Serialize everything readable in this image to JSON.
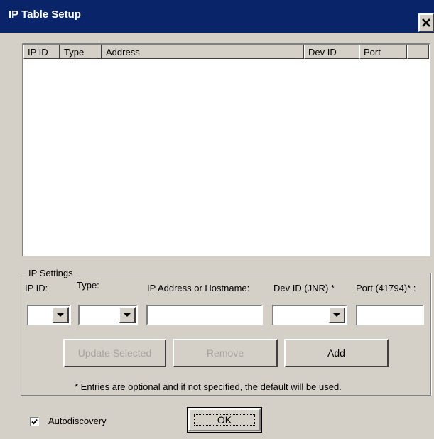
{
  "window": {
    "title": "IP Table Setup",
    "close_icon": "close-icon"
  },
  "table": {
    "columns": [
      "IP ID",
      "Type",
      "Address",
      "Dev ID",
      "Port"
    ],
    "rows": []
  },
  "ip_settings": {
    "group_label": "IP Settings",
    "ip_id": {
      "label": "IP ID:",
      "value": ""
    },
    "type": {
      "label": "Type:",
      "value": ""
    },
    "address": {
      "label": "IP Address or Hostname:",
      "value": ""
    },
    "dev_id": {
      "label": "Dev ID (JNR) *",
      "value": ""
    },
    "port": {
      "label": "Port (41794)* :",
      "value": ""
    },
    "buttons": {
      "update": "Update Selected",
      "remove": "Remove",
      "add": "Add"
    },
    "note": "* Entries are optional and if not specified, the default will be used."
  },
  "autodiscovery": {
    "label": "Autodiscovery",
    "checked": true
  },
  "ok_label": "OK",
  "colors": {
    "titlebar": "#0a246a",
    "face": "#d4d0c8",
    "disabled_text": "#a6a3a0"
  }
}
